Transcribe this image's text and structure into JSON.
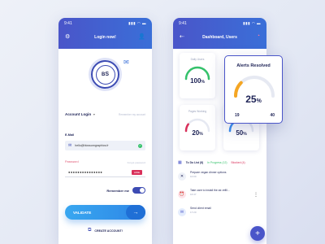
{
  "login": {
    "status_time": "9:41",
    "status_signal": "▮▮▮ ◠ ▬",
    "title": "Login now!",
    "logo_b": "B",
    "logo_s": "S",
    "account_login": "Account Login",
    "remember_account": "Remember my account",
    "email_label": "E-Mail",
    "email_value": "hello@blossomgraphics.fr",
    "password_label": "Password",
    "password_hint": "Forgot password",
    "password_value": "●●●●●●●●●●●●●●●",
    "hide_label": "HIDE",
    "remember_me": "Remember me",
    "validate": "VALIDATE",
    "create_account": "CREATE ACCOUNT!"
  },
  "dashboard": {
    "status_time": "9:41",
    "status_signal": "▮▮▮ ◠ ▬",
    "title": "Dashboard, Users",
    "cards": [
      {
        "title": "Daily Users",
        "percent": "100",
        "color": "#35c26b"
      },
      {
        "title": "Pages Working",
        "percent": "20",
        "color": "#d9305a"
      },
      {
        "title": "",
        "percent": "50",
        "color": "#3a8ef0"
      }
    ],
    "alerts": {
      "title": "Alerts Resolved",
      "percent": "25",
      "min": "19",
      "max": "40",
      "color": "#f5a623"
    },
    "tabs": {
      "todo": "To Do List (8)",
      "inprogress": "In Progress (12)",
      "blocked": "Blocked (4)"
    },
    "tasks": [
      {
        "text": "Prepare vegan dinner options",
        "time": "10:00"
      },
      {
        "text": "Take care to install the air-refill...",
        "time": "16:37"
      },
      {
        "text": "Send client email",
        "time": "17:20"
      }
    ]
  },
  "icons": {
    "login_left": "user-cog-icon",
    "login_right": "add-user-icon",
    "dash_left": "back-arrow-icon",
    "dash_right": "settings-icon",
    "fab": "plus-icon"
  }
}
